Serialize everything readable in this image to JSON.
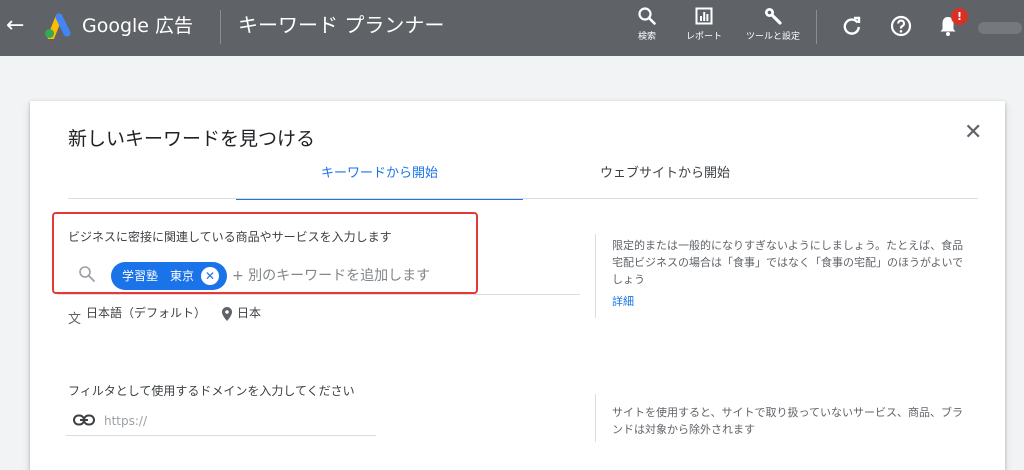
{
  "header": {
    "brand_name": "Google 広告",
    "tool_title": "キーワード プランナー",
    "nav": [
      {
        "label": "検索",
        "icon": "search-icon"
      },
      {
        "label": "レポート",
        "icon": "report-icon"
      },
      {
        "label": "ツールと設定",
        "icon": "wrench-icon"
      }
    ],
    "notification_count": "!"
  },
  "dialog": {
    "title": "新しいキーワードを見つける",
    "close_glyph": "✕",
    "tabs": [
      {
        "label": "キーワードから開始",
        "active": true
      },
      {
        "label": "ウェブサイトから開始",
        "active": false
      }
    ],
    "keyword_section": {
      "label": "ビジネスに密接に関連している商品やサービスを入力します",
      "chips": [
        "学習塾　東京"
      ],
      "placeholder": "+ 別のキーワードを追加します",
      "language": "日本語（デフォルト）",
      "location": "日本",
      "help_text": "限定的または一般的になりすぎないようにしましょう。たとえば、食品宅配ビジネスの場合は「食事」ではなく「食事の宅配」のほうがよいでしょう",
      "details_link": "詳細"
    },
    "domain_section": {
      "label": "フィルタとして使用するドメインを入力してください",
      "placeholder": "https://",
      "help_text": "サイトを使用すると、サイトで取り扱っていないサービス、商品、ブランドは対象から除外されます"
    }
  },
  "colors": {
    "header_bg": "#5f6368",
    "accent": "#1a73e8",
    "highlight_border": "#e53935",
    "badge": "#d93025"
  }
}
